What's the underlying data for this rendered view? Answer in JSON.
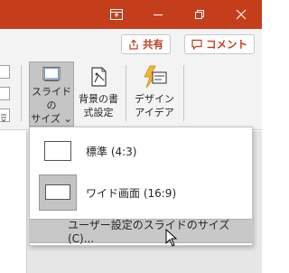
{
  "titlebar": {
    "icons": [
      "restore-ribbon-icon",
      "minimize-icon",
      "restore-icon",
      "close-icon"
    ]
  },
  "header": {
    "share_label": "共有",
    "comment_label": "コメント",
    "accent": "#c43e1c"
  },
  "ribbon": {
    "slide_size_label": "スライドの\nサイズ ⌄",
    "bg_format_label": "背景の書\n式設定",
    "design_ideas_label": "デザイン\nアイデア"
  },
  "dropdown": {
    "items": [
      {
        "label": "標準 (4:3)"
      },
      {
        "label": "ワイド画面 (16:9)"
      },
      {
        "label": "ユーザー設定のスライドのサイズ(C)..."
      }
    ]
  }
}
